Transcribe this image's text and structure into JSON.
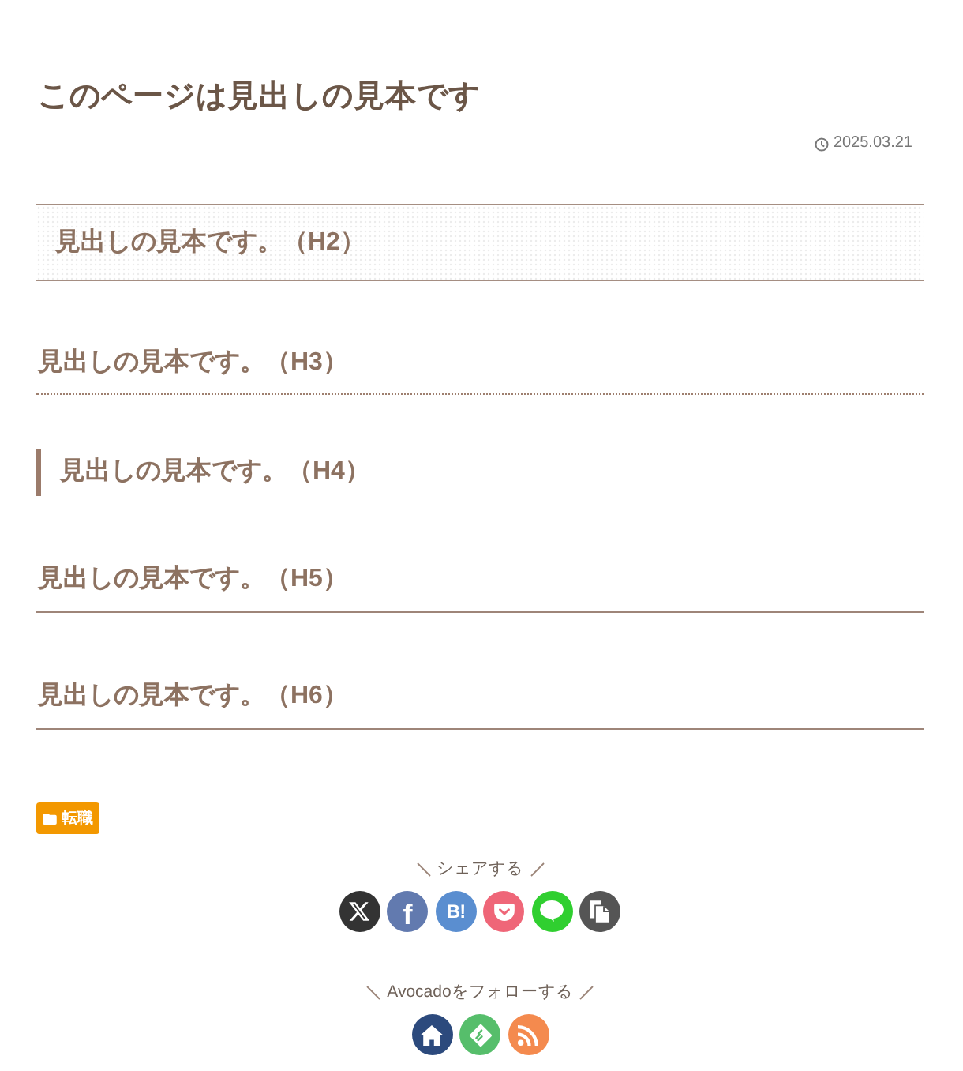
{
  "page": {
    "title": "このページは見出しの見本です",
    "date": "2025.03.21"
  },
  "headings": [
    {
      "kind": "h2",
      "text": "見出しの見本です。（H2）"
    },
    {
      "kind": "h3",
      "text": "見出しの見本です。（H3）"
    },
    {
      "kind": "h4",
      "text": "見出しの見本です。（H4）"
    },
    {
      "kind": "h5",
      "text": "見出しの見本です。（H5）"
    },
    {
      "kind": "h6",
      "text": "見出しの見本です。（H6）"
    }
  ],
  "category": {
    "label": "転職"
  },
  "share": {
    "title": "シェアする",
    "buttons": [
      {
        "kind": "x",
        "color": "#333333"
      },
      {
        "kind": "facebook",
        "label": "f",
        "color": "#627aaf"
      },
      {
        "kind": "hatena",
        "label": "B!",
        "color": "#5a8ed0"
      },
      {
        "kind": "pocket",
        "color": "#ef6678"
      },
      {
        "kind": "line",
        "color": "#30cf30"
      },
      {
        "kind": "copy",
        "color": "#555555"
      }
    ]
  },
  "follow": {
    "title": "Avocadoをフォローする",
    "buttons": [
      {
        "kind": "home",
        "color": "#2c4a7d"
      },
      {
        "kind": "feedly",
        "color": "#56be6b"
      },
      {
        "kind": "rss",
        "color": "#f48a4e"
      }
    ]
  }
}
